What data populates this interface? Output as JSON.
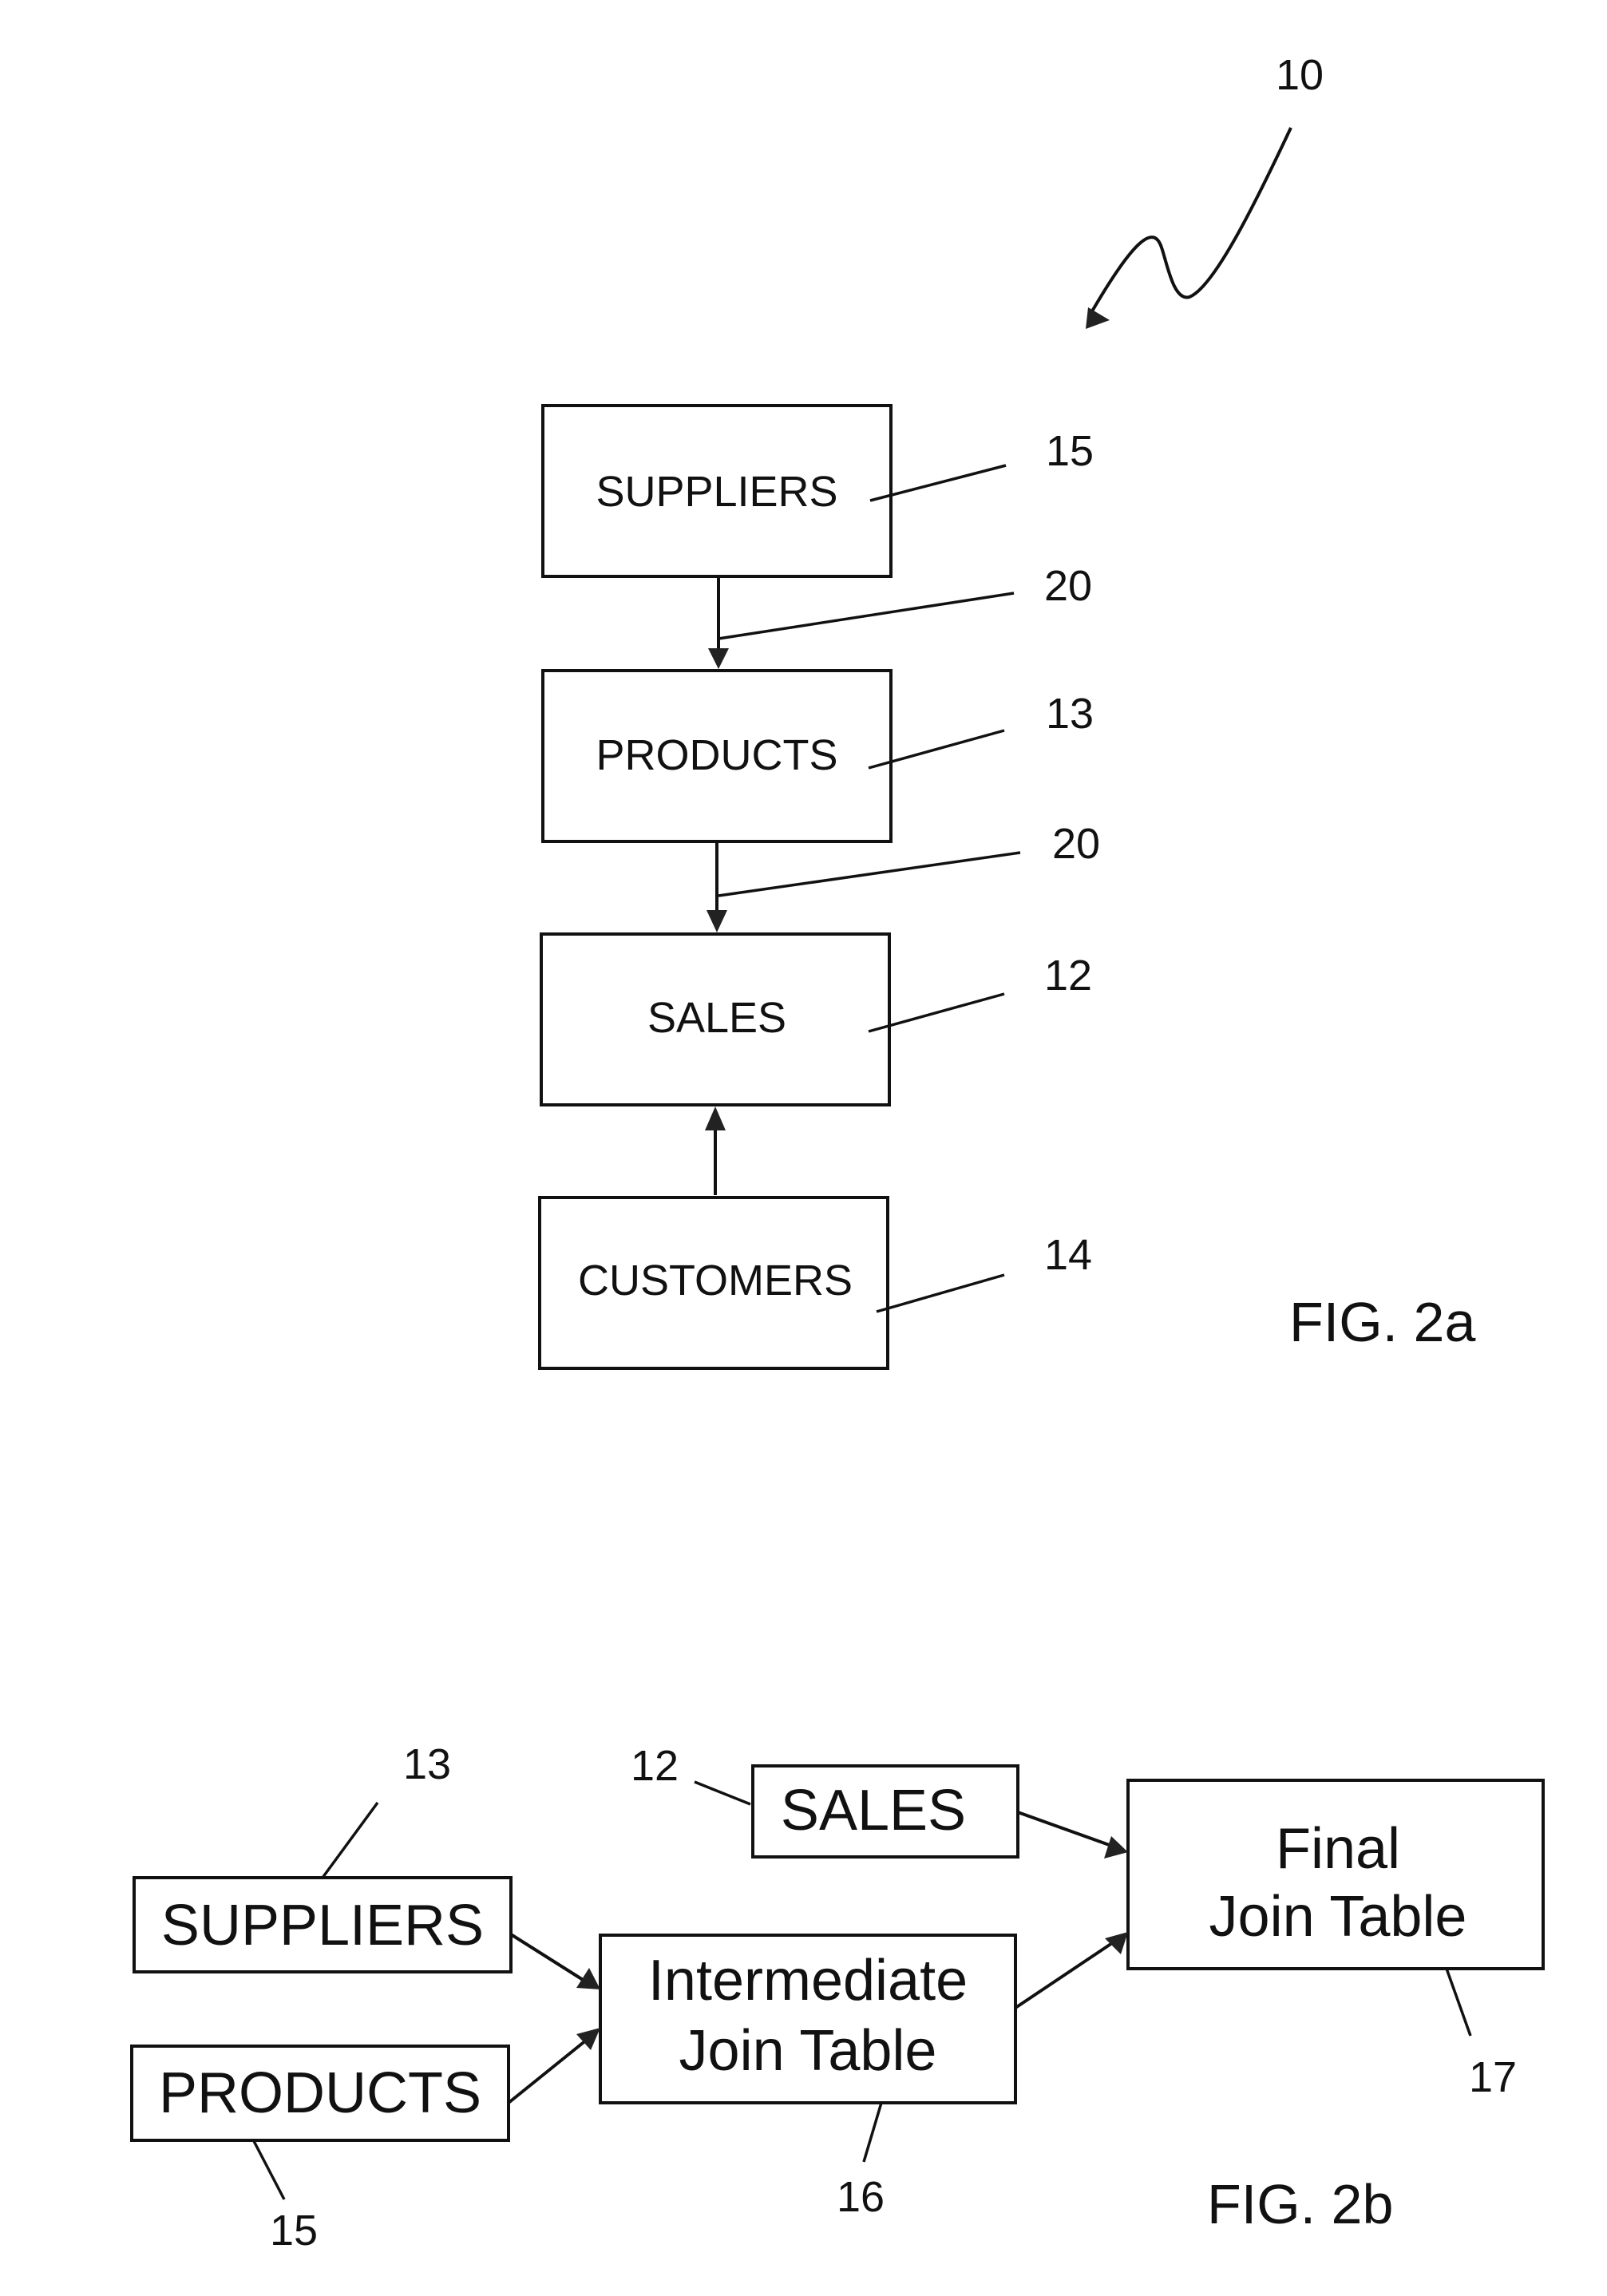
{
  "figures": [
    {
      "id": "fig2a",
      "caption": "FIG. 2a",
      "overall_ref": "10",
      "tables": [
        {
          "key": "suppliers",
          "label": "SUPPLIERS",
          "ref": "15"
        },
        {
          "key": "products",
          "label": "PRODUCTS",
          "ref": "13"
        },
        {
          "key": "sales",
          "label": "SALES",
          "ref": "12"
        },
        {
          "key": "customers",
          "label": "CUSTOMERS",
          "ref": "14"
        }
      ],
      "connections": [
        {
          "from": "suppliers",
          "to": "products",
          "ref": "20"
        },
        {
          "from": "products",
          "to": "sales",
          "ref": "20"
        },
        {
          "from": "customers",
          "to": "sales",
          "ref": ""
        }
      ]
    },
    {
      "id": "fig2b",
      "caption": "FIG. 2b",
      "tables": [
        {
          "key": "suppliers",
          "label": "SUPPLIERS",
          "ref": "13"
        },
        {
          "key": "products",
          "label": "PRODUCTS",
          "ref": "15"
        },
        {
          "key": "sales",
          "label": "SALES",
          "ref": "12"
        },
        {
          "key": "intermediate",
          "label_lines": [
            "Intermediate",
            "Join Table"
          ],
          "ref": "16"
        },
        {
          "key": "final",
          "label_lines": [
            "Final",
            "Join Table"
          ],
          "ref": "17"
        }
      ],
      "connections": [
        {
          "from": "suppliers",
          "to": "intermediate"
        },
        {
          "from": "products",
          "to": "intermediate"
        },
        {
          "from": "sales",
          "to": "final"
        },
        {
          "from": "intermediate",
          "to": "final"
        }
      ]
    }
  ]
}
